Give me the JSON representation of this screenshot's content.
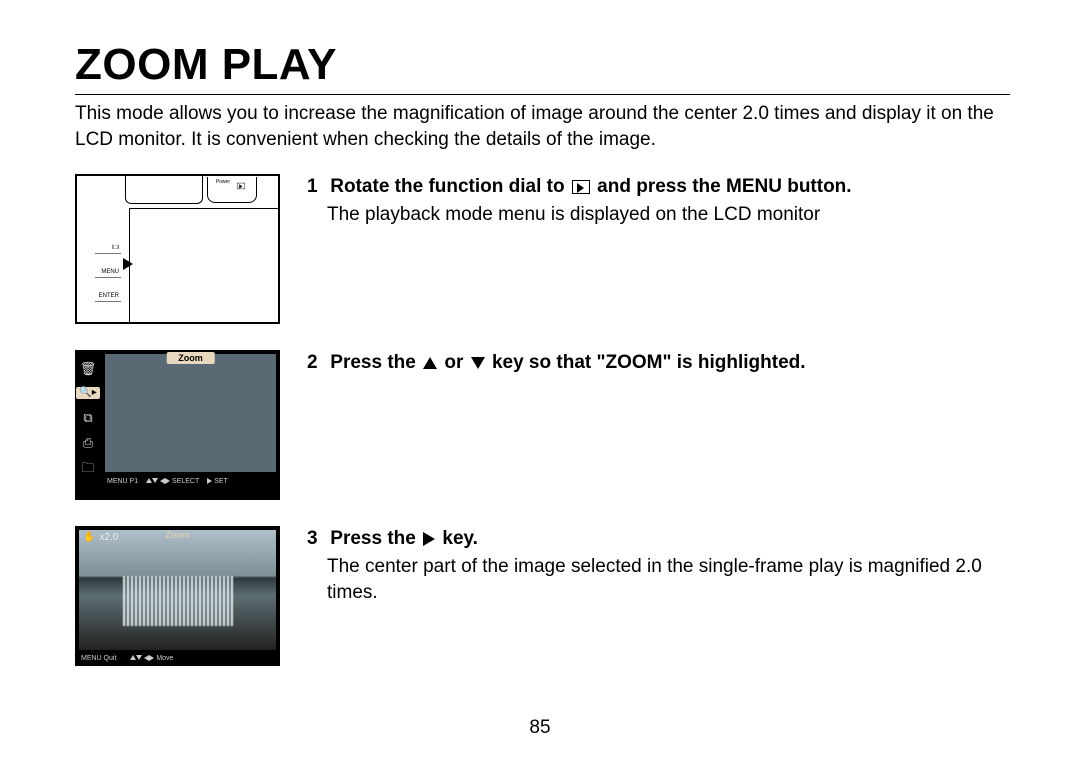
{
  "title": "ZOOM PLAY",
  "intro": "This mode allows you to increase the magnification of image around the center 2.0 times and display it on the LCD monitor. It is convenient when checking the details of the image.",
  "steps": [
    {
      "num": "1",
      "head_before": "Rotate the function dial to",
      "head_after": "and press the MENU button.",
      "body": "The playback mode menu is displayed on the LCD monitor"
    },
    {
      "num": "2",
      "head_before": "Press the",
      "head_mid": "or",
      "head_after": "key so that \"ZOOM\" is highlighted."
    },
    {
      "num": "3",
      "head_before": "Press the",
      "head_after": "key.",
      "body": "The center part of the image selected in the single-frame play is magnified 2.0 times."
    }
  ],
  "thumb1": {
    "power": "Power",
    "btns": [
      "I□I",
      "MENU",
      "ENTER"
    ]
  },
  "thumb2": {
    "tab": "Zoom",
    "footer": {
      "menu": "MENU P1",
      "select": "SELECT",
      "set": "SET"
    }
  },
  "thumb3": {
    "tab": "Zoom",
    "mag": "x2.0",
    "footer": {
      "menu": "MENU Quit",
      "move": "Move"
    }
  },
  "page_number": "85"
}
